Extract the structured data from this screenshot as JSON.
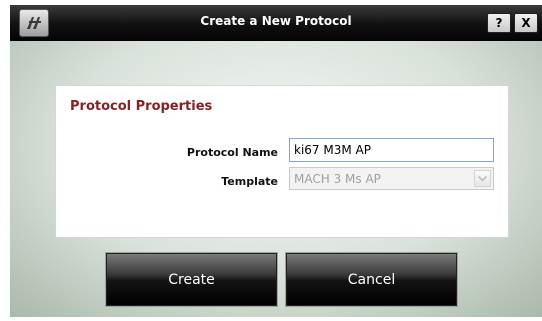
{
  "window": {
    "title": "Create a New Protocol"
  },
  "titlebar": {
    "help_label": "?",
    "close_label": "X"
  },
  "panel": {
    "heading": "Protocol Properties",
    "protocol_name": {
      "label": "Protocol Name",
      "value": "ki67 M3M AP"
    },
    "template": {
      "label": "Template",
      "value": "MACH 3 Ms AP",
      "enabled": false
    }
  },
  "buttons": {
    "create": "Create",
    "cancel": "Cancel"
  },
  "colors": {
    "heading": "#8a1f1f",
    "focus_border": "#7fa7d9",
    "disabled_text": "#a0a0a0"
  }
}
